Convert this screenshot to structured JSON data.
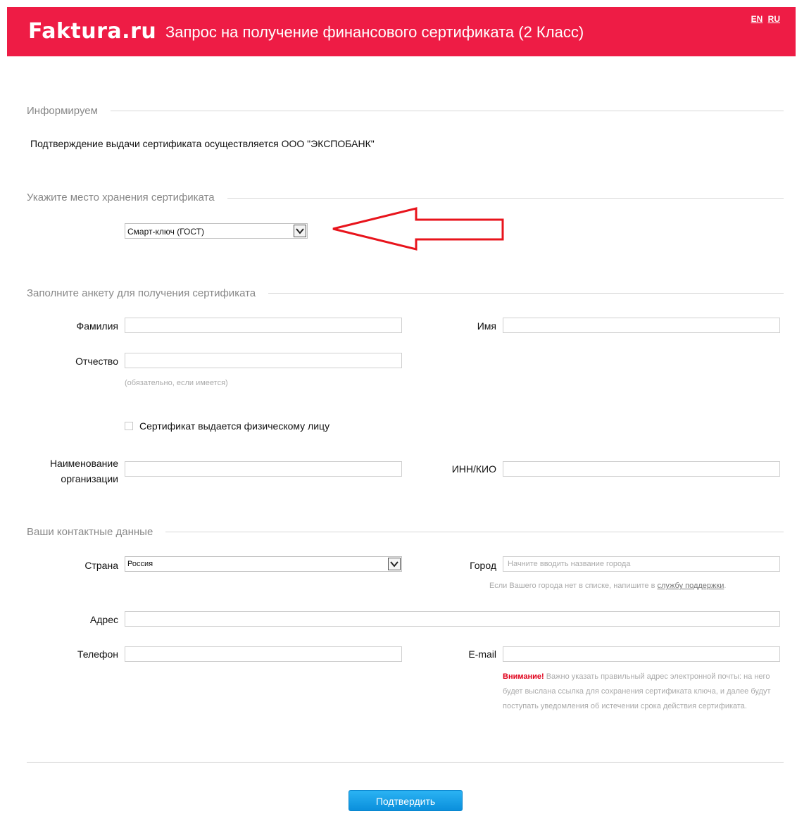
{
  "header": {
    "logo": "Faktura.ru",
    "title": "Запрос на получение финансового сертификата (2 Класс)",
    "lang_en": "EN",
    "lang_ru": "RU",
    "bg_color": "#ee1c45"
  },
  "info": {
    "section_title": "Информируем",
    "text": "Подтверждение выдачи сертификата осуществляется ООО \"ЭКСПОБАНК\""
  },
  "storage": {
    "section_title": "Укажите место хранения сертификата",
    "selected": "Смарт-ключ (ГОСТ)"
  },
  "form": {
    "section_title": "Заполните анкету для получения сертификата",
    "surname_label": "Фамилия",
    "name_label": "Имя",
    "patronymic_label": "Отчество",
    "patronymic_hint": "(обязательно, если имеется)",
    "individual_checkbox_label": "Сертификат выдается физическому лицу",
    "org_label_line1": "Наименование",
    "org_label_line2": "организации",
    "inn_label": "ИНН/КИО"
  },
  "contacts": {
    "section_title": "Ваши контактные данные",
    "country_label": "Страна",
    "country_value": "Россия",
    "city_label": "Город",
    "city_placeholder": "Начните вводить название города",
    "city_hint_prefix": "Если Вашего города нет в списке, напишите в ",
    "city_hint_link": "службу поддержки",
    "city_hint_suffix": ".",
    "address_label": "Адрес",
    "phone_label": "Телефон",
    "email_label": "E-mail",
    "warning_strong": "Внимание!",
    "warning_text": " Важно указать правильный адрес электронной почты: на него будет выслана ссылка для сохранения сертификата ключа, и далее будут поступать уведомления об истечении срока действия сертификата."
  },
  "submit_label": "Подтвердить",
  "annotation_color": "#e8141c"
}
